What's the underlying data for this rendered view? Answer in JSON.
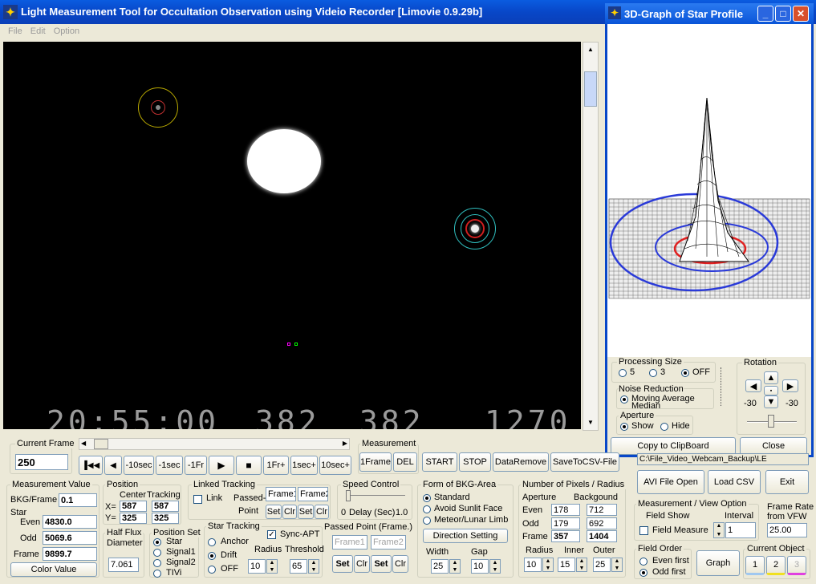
{
  "app": {
    "title": "Light Measurement Tool for Occultation Observation using Videio Recorder [Limovie 0.9.29b]"
  },
  "menu": [
    "File",
    "Edit",
    "Option"
  ],
  "overlay": {
    "time": "20:55:00",
    "n1": "382",
    "n2": "382",
    "n3": "1270"
  },
  "graph3d": {
    "title": "3D-Graph of Star Profile"
  },
  "processing": {
    "label": "Processing Size",
    "o1": "5",
    "o2": "3",
    "o3": "OFF"
  },
  "noise": {
    "label": "Noise Reduction",
    "o1": "Moving Average",
    "o2": "Median"
  },
  "aperture_opt": {
    "label": "Aperture",
    "show": "Show",
    "hide": "Hide"
  },
  "rotation": {
    "label": "Rotation",
    "left": "-30",
    "right": "-30"
  },
  "copy_btn": "Copy to ClipBoard",
  "close_btn": "Close",
  "current_frame": {
    "label": "Current Frame",
    "value": "250"
  },
  "nav": [
    "10sec",
    "1sec",
    "1Fr",
    "1Fr+",
    "1sec+",
    "10sec+"
  ],
  "measurement": {
    "label": "Measurement",
    "b1": "1Frame",
    "b2": "DEL",
    "b3": "START",
    "b4": "STOP",
    "b5": "DataRemove",
    "b6": "SaveToCSV-File"
  },
  "mv": {
    "label": "Measurement Value",
    "bkg_label": "BKG/Frame",
    "bkg": "0.1",
    "star": "Star",
    "even_label": "Even",
    "even": "4830.0",
    "odd_label": "Odd",
    "odd": "5069.6",
    "frame_label": "Frame",
    "frame": "9899.7",
    "color_btn": "Color Value"
  },
  "position": {
    "label": "Position",
    "center": "Center",
    "tracking": "Tracking",
    "x": "X=",
    "y": "Y=",
    "cx": "587",
    "tx": "587",
    "cy": "325",
    "ty": "325"
  },
  "halfflux": {
    "label": "Half Flux",
    "diam": "Diameter",
    "value": "7.061"
  },
  "posset": {
    "label": "Position Set",
    "o1": "Star",
    "o2": "Signal1",
    "o3": "Signal2",
    "o4": "TIVi"
  },
  "linked": {
    "label": "Linked Tracking",
    "link": "Link",
    "passed": "Passed-",
    "point": "Point",
    "f1": "Frame1",
    "f2": "Frame2",
    "set": "Set",
    "clr": "Clr"
  },
  "speed": {
    "label": "Speed Control",
    "min": "0",
    "delay": "Delay (Sec)",
    "max": "1.0"
  },
  "startrack": {
    "label": "Star Tracking",
    "anchor": "Anchor",
    "drift": "Drift",
    "off": "OFF",
    "sync": "Sync-APT",
    "radius": "Radius",
    "threshold": "Threshold",
    "rv": "10",
    "tv": "65"
  },
  "passedpt": {
    "label": "Passed Point (Frame.)",
    "f1": "Frame1",
    "f2": "Frame2",
    "set": "Set",
    "clr": "Clr"
  },
  "bkg": {
    "label": "Form of BKG-Area",
    "o1": "Standard",
    "o2": "Avoid Sunlit Face",
    "o3": "Meteor/Lunar Limb",
    "dir": "Direction Setting",
    "width": "Width",
    "gap": "Gap",
    "wv": "25",
    "gv": "10"
  },
  "pixels": {
    "label": "Number of Pixels / Radius",
    "ap": "Aperture",
    "bg": "Backgound",
    "even": "Even",
    "odd": "Odd",
    "frame": "Frame",
    "ae": "178",
    "be": "712",
    "ao": "179",
    "bo": "692",
    "af": "357",
    "bf": "1404",
    "radius": "Radius",
    "inner": "Inner",
    "outer": "Outer",
    "rv": "10",
    "iv": "15",
    "ov": "25"
  },
  "filepath": "C:\\File_Video_Webcam_Backup\\LE",
  "avi_btn": "AVI File Open",
  "csv_btn": "Load CSV",
  "exit_btn": "Exit",
  "mvopt": {
    "label": "Measurement / View Option",
    "fieldshow": "Field Show",
    "interval": "Interval",
    "iv": "1",
    "fieldmeasure": "Field Measure"
  },
  "framerate": {
    "label": "Frame Rate",
    "from": "from VFW",
    "value": "25.00"
  },
  "fieldorder": {
    "label": "Field Order",
    "even": "Even first",
    "odd": "Odd first"
  },
  "graph_btn": "Graph",
  "curobj": {
    "label": "Current Object",
    "o1": "1",
    "o2": "2",
    "o3": "3"
  }
}
